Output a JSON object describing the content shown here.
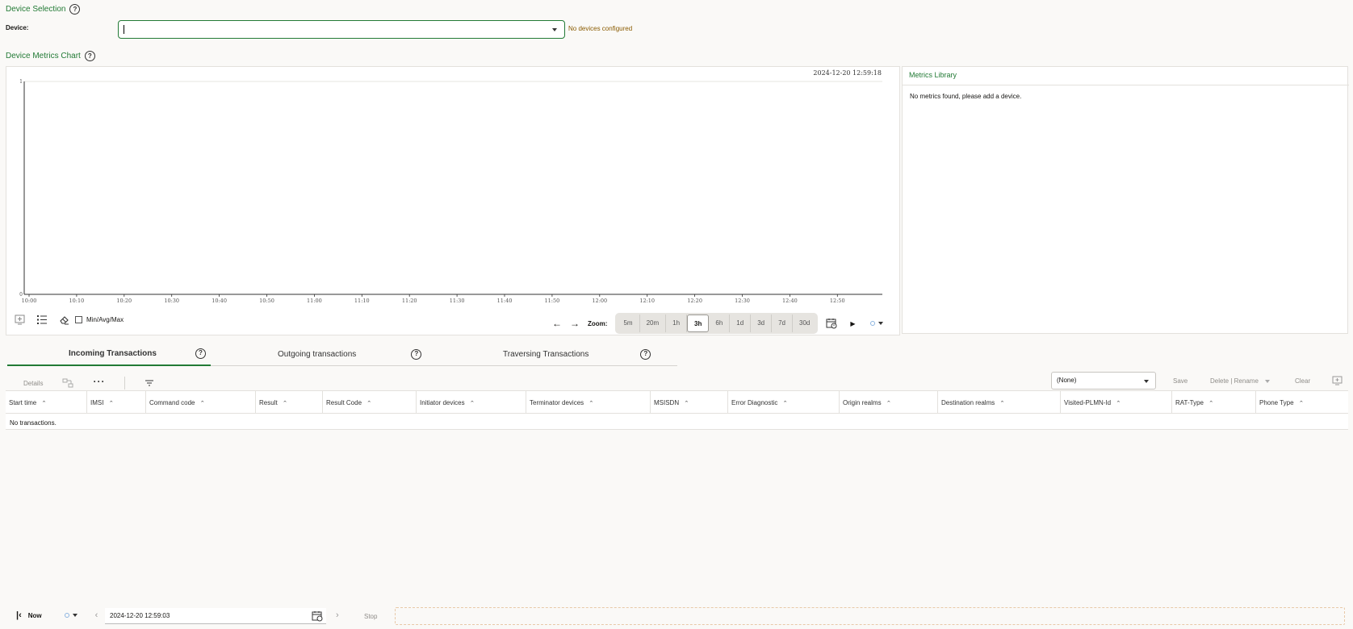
{
  "device_selection": {
    "title": "Device Selection",
    "label": "Device:",
    "input_value": "",
    "status": "No devices configured"
  },
  "chart_section": {
    "title": "Device Metrics Chart",
    "timestamp": "2024-12-20 12:59:18",
    "min_avg_max_label": "Min/Avg/Max",
    "zoom_label": "Zoom:",
    "zoom_options": [
      "5m",
      "20m",
      "1h",
      "3h",
      "6h",
      "1d",
      "3d",
      "7d",
      "30d"
    ],
    "zoom_selected": "3h"
  },
  "chart_data": {
    "type": "line",
    "title": "",
    "xlabel": "",
    "ylabel": "",
    "x_ticks": [
      "10:00",
      "10:10",
      "10:20",
      "10:30",
      "10:40",
      "10:50",
      "11:00",
      "11:10",
      "11:20",
      "11:30",
      "11:40",
      "11:50",
      "12:00",
      "12:10",
      "12:20",
      "12:30",
      "12:40",
      "12:50"
    ],
    "y_ticks": [
      "0",
      "1"
    ],
    "ylim": [
      0,
      1
    ],
    "series": [],
    "grid": false
  },
  "metrics_library": {
    "title": "Metrics Library",
    "empty_text": "No metrics found, please add a device."
  },
  "tabs": [
    {
      "label": "Incoming Transactions",
      "active": true
    },
    {
      "label": "Outgoing transactions",
      "active": false
    },
    {
      "label": "Traversing Transactions",
      "active": false
    }
  ],
  "table_toolbar": {
    "details_label": "Details",
    "filter_select_value": "(None)",
    "save_label": "Save",
    "delete_rename_label": "Delete | Rename",
    "clear_label": "Clear"
  },
  "table": {
    "columns": [
      "Start time",
      "IMSI",
      "Command code",
      "Result",
      "Result Code",
      "Initiator devices",
      "Terminator devices",
      "MSISDN",
      "Error Diagnostic",
      "Origin realms",
      "Destination realms",
      "Visited-PLMN-Id",
      "RAT-Type",
      "Phone Type"
    ],
    "empty_text": "No transactions."
  },
  "footer": {
    "now_label": "Now",
    "datetime_value": "2024-12-20 12:59:03",
    "stop_label": "Stop"
  },
  "colors": {
    "accent_green": "#227a35",
    "warning_text": "#8a5b00",
    "background": "#faf9f7"
  }
}
